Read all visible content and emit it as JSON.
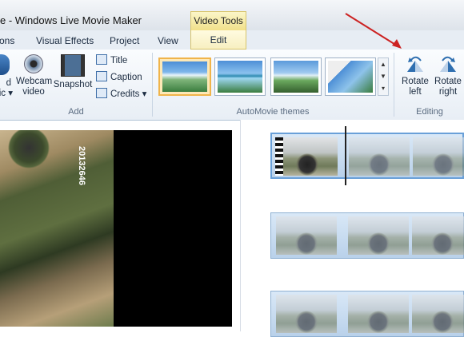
{
  "window": {
    "title": "e - Windows Live Movie Maker",
    "context_tab": "Video Tools"
  },
  "tabs": [
    {
      "label": "ons"
    },
    {
      "label": "Visual Effects"
    },
    {
      "label": "Project"
    },
    {
      "label": "View"
    },
    {
      "label": "Edit"
    }
  ],
  "ribbon": {
    "add": {
      "label": "Add",
      "partial_button_line1": "d",
      "partial_button_line2": "ic ▾",
      "webcam_line1": "Webcam",
      "webcam_line2": "video",
      "snapshot": "Snapshot",
      "title": "Title",
      "caption": "Caption",
      "credits": "Credits ▾"
    },
    "themes": {
      "label": "AutoMovie themes"
    },
    "editing": {
      "label": "Editing",
      "rotate_left_line1": "Rotate",
      "rotate_left_line2": "left",
      "rotate_right_line1": "Rotate",
      "rotate_right_line2": "right"
    }
  },
  "preview": {
    "plate_text": "20132646"
  },
  "colors": {
    "accent": "#f0b44a",
    "arrow": "#cc2222",
    "context_tab": "#f1e08a"
  }
}
